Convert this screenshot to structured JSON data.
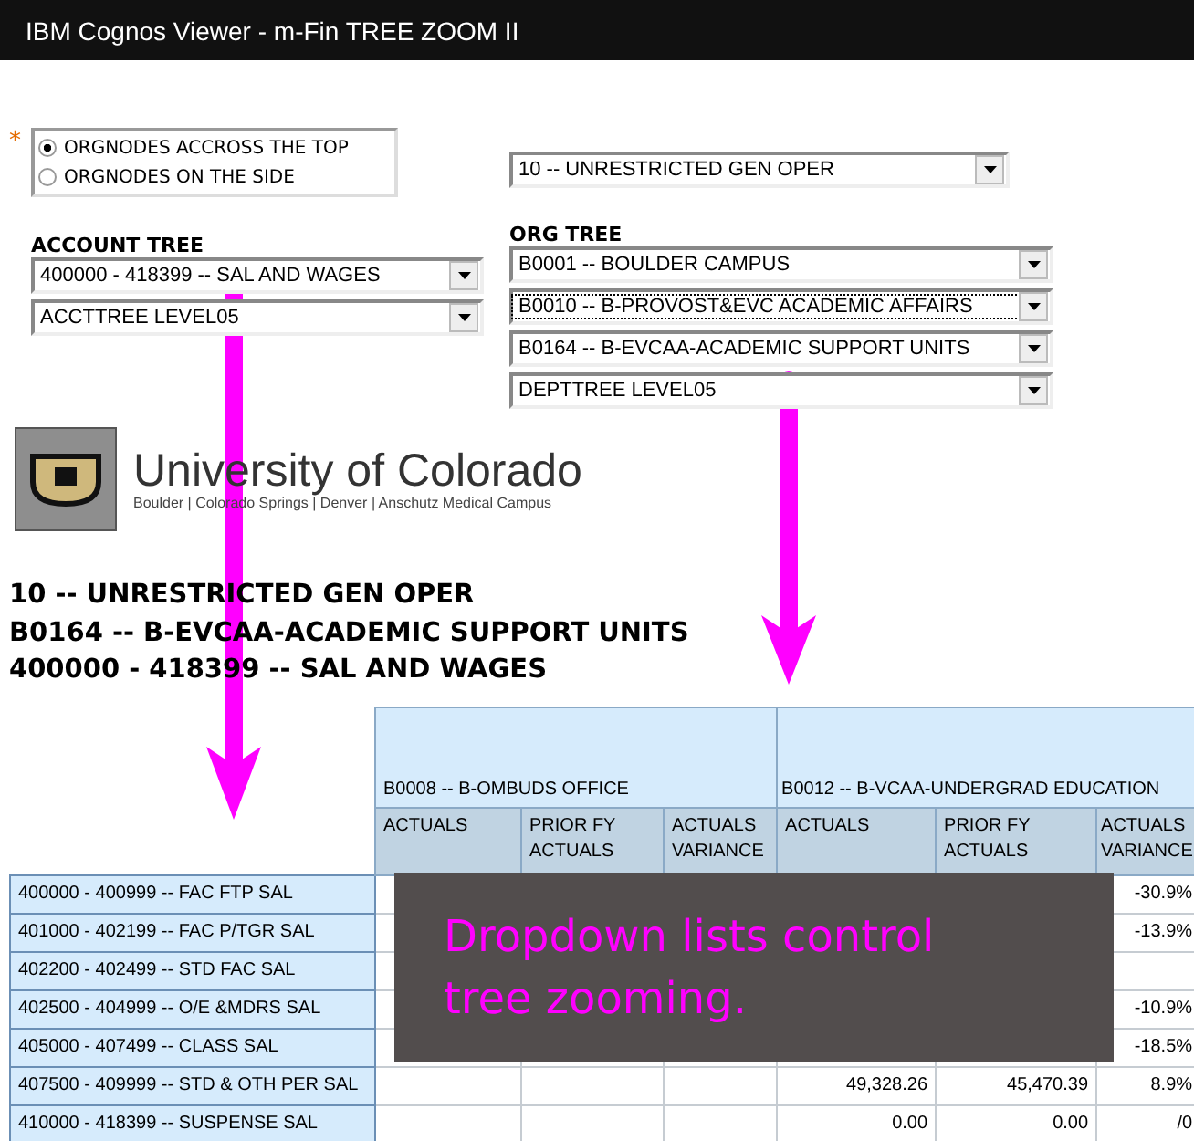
{
  "window": {
    "title": "IBM Cognos Viewer - m-Fin TREE ZOOM II"
  },
  "prompts": {
    "required_mark": "*",
    "layout_options": [
      {
        "label": "ORGNODES ACCROSS THE TOP",
        "selected": true
      },
      {
        "label": "ORGNODES ON THE SIDE",
        "selected": false
      }
    ],
    "fund_select": {
      "value": "10 -- UNRESTRICTED GEN OPER"
    },
    "account_tree": {
      "label": "ACCOUNT TREE",
      "selects": [
        {
          "value": "400000 - 418399 -- SAL AND WAGES",
          "focused": false
        },
        {
          "value": "ACCTTREE LEVEL05",
          "focused": false
        }
      ]
    },
    "org_tree": {
      "label": "ORG TREE",
      "selects": [
        {
          "value": "B0001 -- BOULDER CAMPUS",
          "focused": false
        },
        {
          "value": "B0010 -- B-PROVOST&EVC ACADEMIC AFFAIRS",
          "focused": true
        },
        {
          "value": "B0164 -- B-EVCAA-ACADEMIC SUPPORT UNITS",
          "focused": false
        },
        {
          "value": "DEPTTREE LEVEL05",
          "focused": false
        }
      ]
    }
  },
  "logo": {
    "name": "University of Colorado",
    "tagline": "Boulder | Colorado Springs | Denver | Anschutz Medical Campus"
  },
  "report_headings": [
    "10 -- UNRESTRICTED GEN OPER",
    "B0164 -- B-EVCAA-ACADEMIC SUPPORT UNITS",
    "400000 - 418399 -- SAL AND WAGES"
  ],
  "table": {
    "groups": [
      "B0008 -- B-OMBUDS OFFICE",
      "B0012 -- B-VCAA-UNDERGRAD EDUCATION"
    ],
    "columns": [
      "ACTUALS",
      "PRIOR FY ACTUALS",
      "ACTUALS VARIANCE",
      "ACTUALS",
      "PRIOR FY ACTUALS",
      "ACTUALS VARIANCE"
    ],
    "rows": [
      {
        "label": "400000 - 400999 -- FAC FTP SAL",
        "column_6": "-30.9%"
      },
      {
        "label": "401000 - 402199 -- FAC P/TGR SAL",
        "column_6": "-13.9%"
      },
      {
        "label": "402200 - 402499 -- STD FAC SAL"
      },
      {
        "label": "402500 - 404999 -- O/E &MDRS SAL",
        "column_6": "-10.9%"
      },
      {
        "label": "405000 - 407499 -- CLASS SAL",
        "column_6": "-18.5%"
      },
      {
        "label": "407500 - 409999 -- STD & OTH PER SAL",
        "column_4": "49,328.26",
        "column_5": "45,470.39",
        "column_6": "8.9%"
      },
      {
        "label": "410000 - 418399 -- SUSPENSE SAL",
        "column_4": "0.00",
        "column_5": "0.00",
        "column_6": "/0"
      }
    ]
  },
  "callout": {
    "text": "Dropdown lists control tree zooming."
  }
}
